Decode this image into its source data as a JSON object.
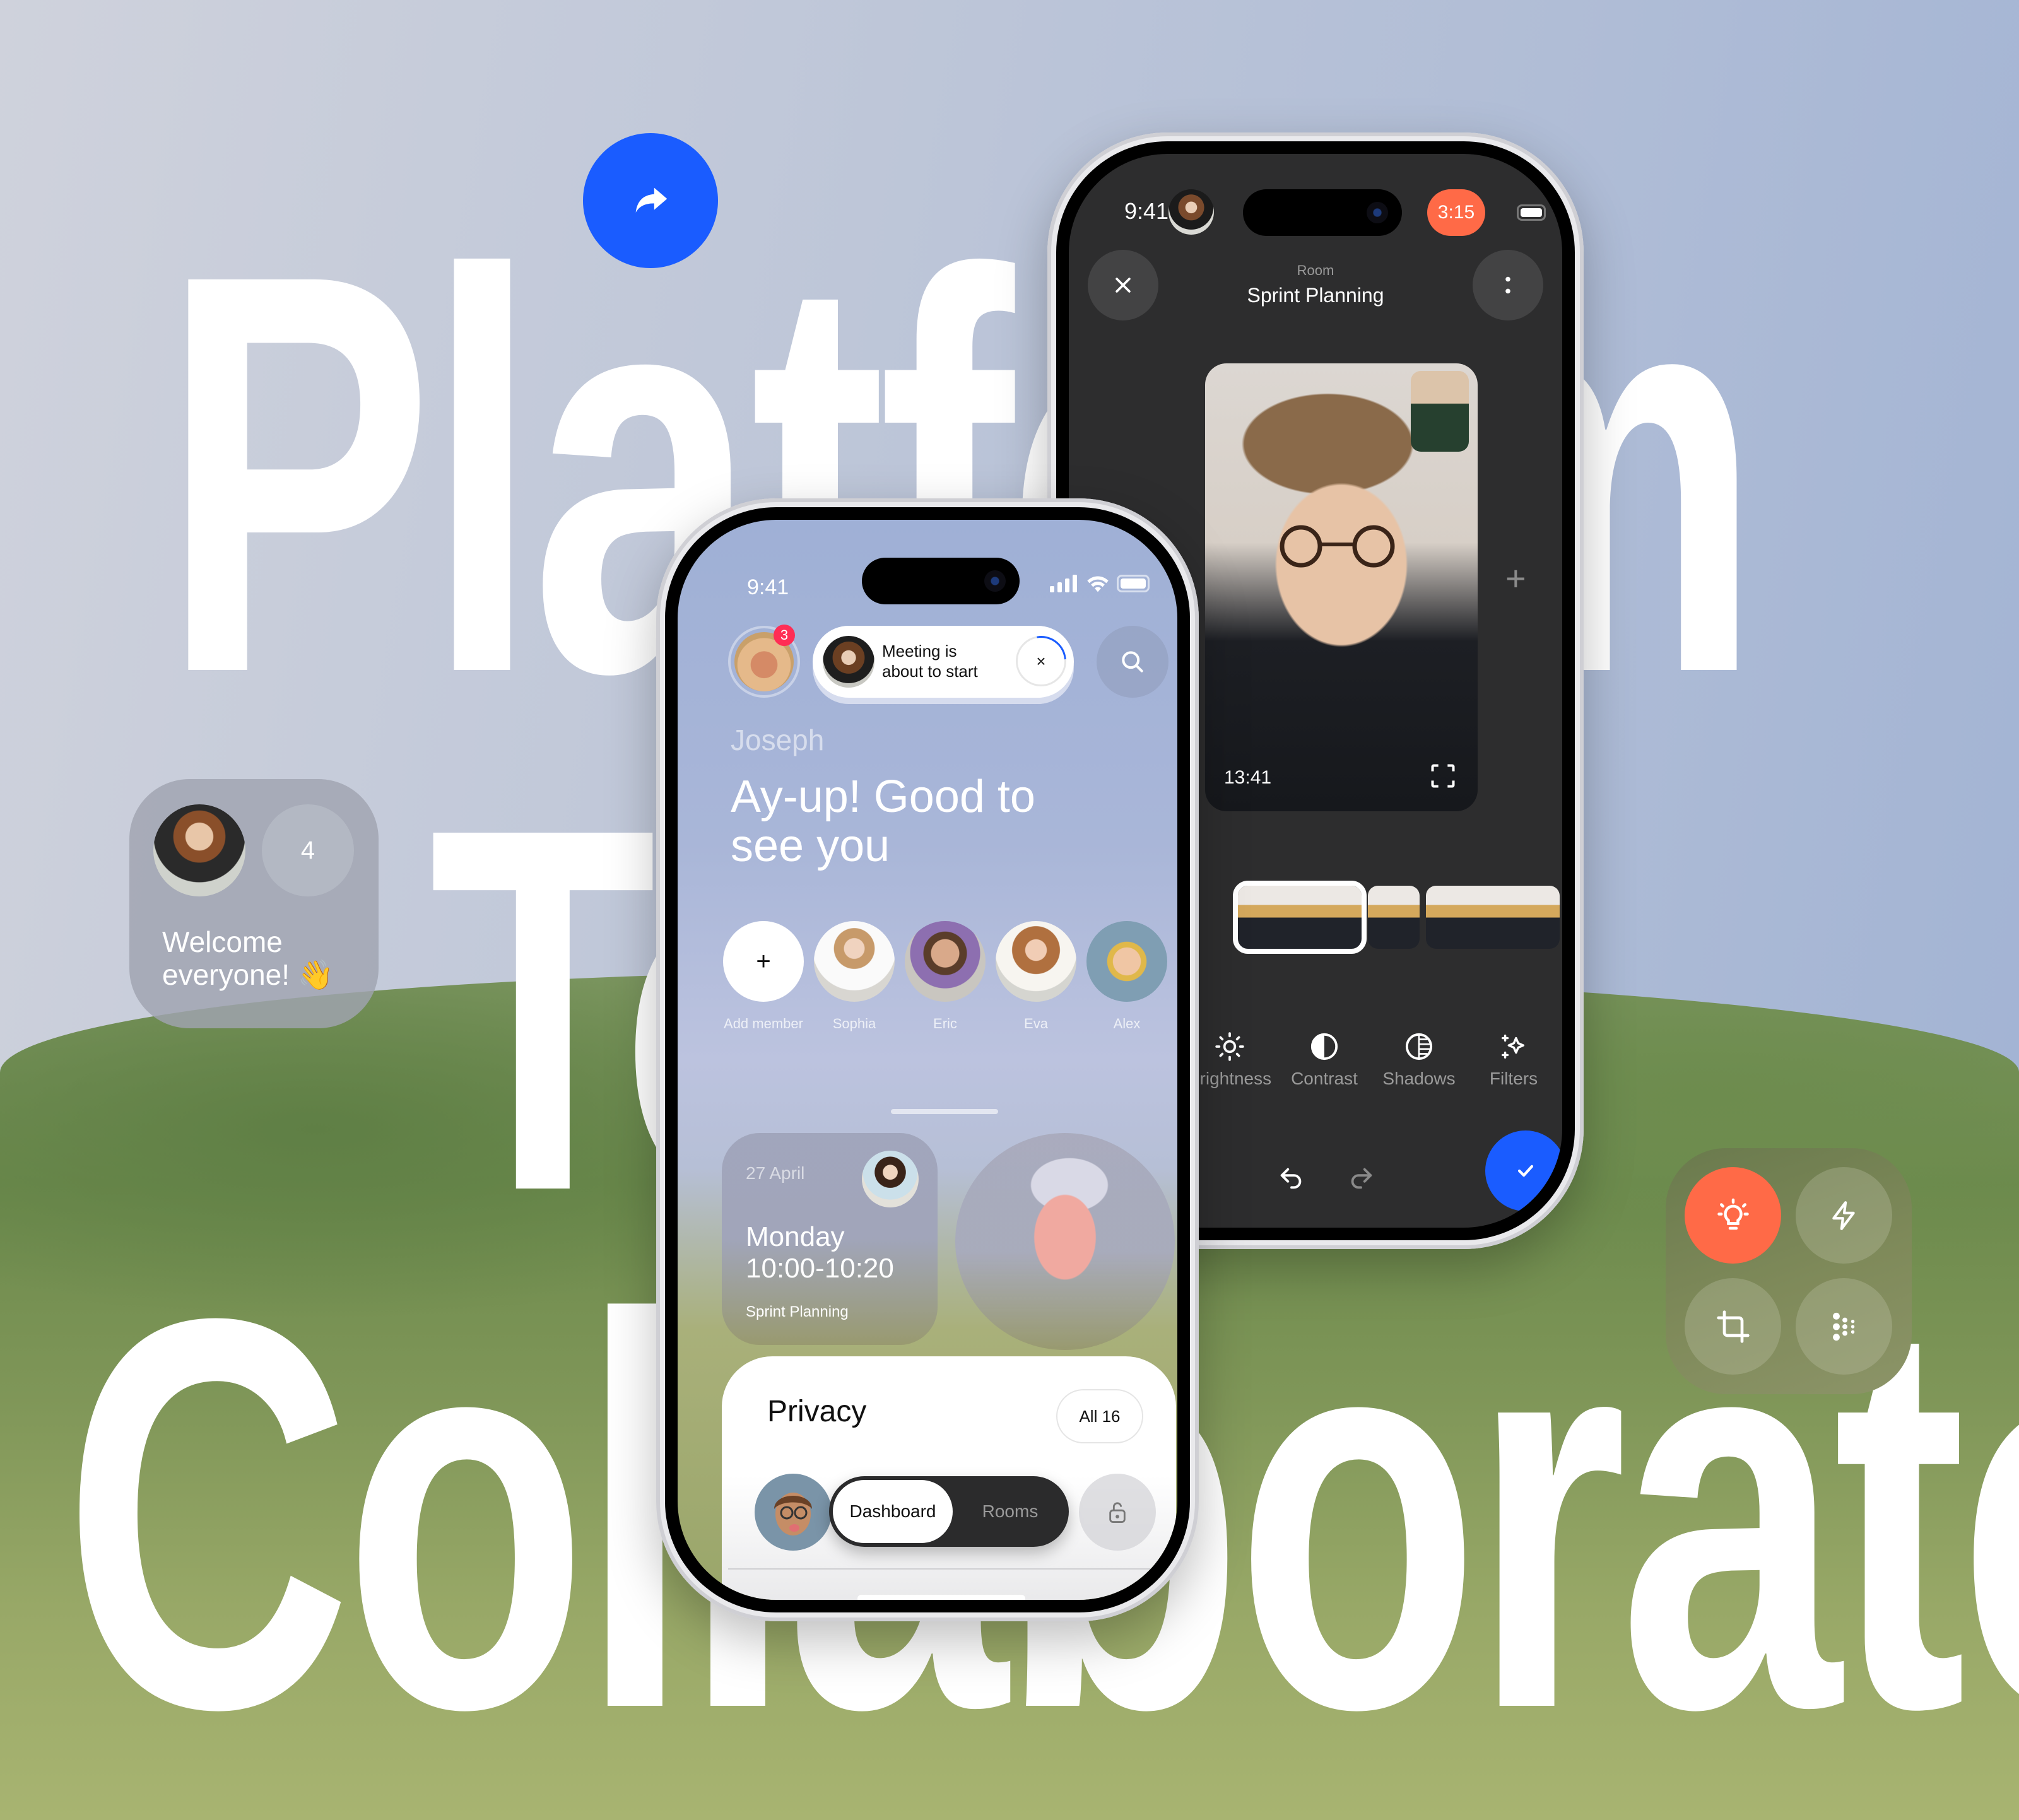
{
  "headline": {
    "line1": "Platform",
    "line2": "To",
    "line3": "Collaborate"
  },
  "colors": {
    "accent_blue": "#1a5cff",
    "accent_orange": "#ff6a47",
    "badge_red": "#ff2d55",
    "dark_screen": "#2d2d2e"
  },
  "share_button": {
    "icon": "share-arrow-icon"
  },
  "welcome_widget": {
    "member_count": "4",
    "message": "Welcome everyone! 👋"
  },
  "controls_widget": {
    "buttons": [
      {
        "icon": "lightbulb-icon",
        "active": true
      },
      {
        "icon": "lightning-icon",
        "active": false
      },
      {
        "icon": "crop-icon",
        "active": false
      },
      {
        "icon": "dots-grid-icon",
        "active": false
      }
    ]
  },
  "dark_phone": {
    "status": {
      "time": "9:41",
      "call_timer": "3:15"
    },
    "header": {
      "overline": "Room",
      "title": "Sprint Planning"
    },
    "video": {
      "elapsed": "13:41"
    },
    "tools": [
      {
        "label": "Brightness",
        "icon": "sun-icon"
      },
      {
        "label": "Contrast",
        "icon": "contrast-icon"
      },
      {
        "label": "Shadows",
        "icon": "shadows-icon"
      },
      {
        "label": "Filters",
        "icon": "sparkles-icon"
      }
    ],
    "actions": {
      "undo": "undo-icon",
      "redo": "redo-icon",
      "confirm": "check-icon"
    }
  },
  "light_phone": {
    "status": {
      "time": "9:41"
    },
    "notifications_badge": "3",
    "notification": {
      "line1": "Meeting is",
      "line2": "about to start",
      "dismiss": "×"
    },
    "greeting": {
      "name": "Joseph",
      "line1": "Ay-up! Good to",
      "line2": "see you"
    },
    "members": [
      {
        "name": "Add member",
        "glyph": "+"
      },
      {
        "name": "Sophia"
      },
      {
        "name": "Eric"
      },
      {
        "name": "Eva"
      },
      {
        "name": "Alex"
      }
    ],
    "event": {
      "date": "27 April",
      "day": "Monday",
      "time": "10:00-10:20",
      "title": "Sprint Planning"
    },
    "sheet": {
      "title": "Privacy",
      "all_button": "All 16",
      "tabs": [
        "Dashboard",
        "Rooms"
      ],
      "active_tab": "Dashboard"
    }
  }
}
